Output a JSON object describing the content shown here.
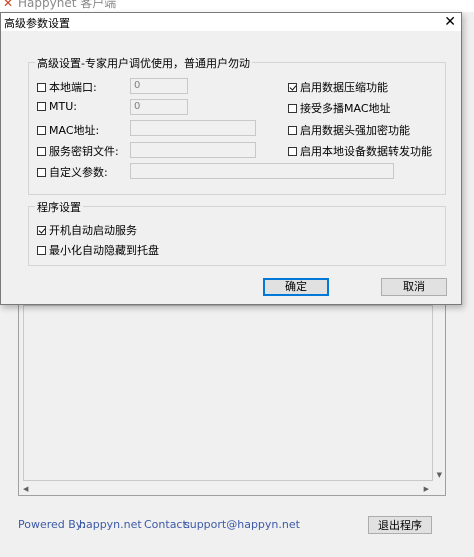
{
  "main_window": {
    "title": "Happynet 客户端",
    "footer_powered_label": "Powered By:",
    "footer_powered_link": "happyn.net",
    "footer_contact_label": "Contact:",
    "footer_contact_email": "support@happyn.net",
    "exit_button": "退出程序"
  },
  "dialog": {
    "title": "高级参数设置",
    "close_glyph": "✕",
    "advanced_group": {
      "label": "高级设置-专家用户调优使用，普通用户勿动",
      "local_port": {
        "label": "本地端口:",
        "checked": false,
        "value": "0"
      },
      "mtu": {
        "label": "MTU:",
        "checked": false,
        "value": "0"
      },
      "mac": {
        "label": "MAC地址:",
        "checked": false,
        "value": ""
      },
      "service_key": {
        "label": "服务密钥文件:",
        "checked": false,
        "value": ""
      },
      "custom_params": {
        "label": "自定义参数:",
        "checked": false,
        "value": ""
      },
      "compression": {
        "label": "启用数据压缩功能",
        "checked": true
      },
      "multicast": {
        "label": "接受多播MAC地址",
        "checked": false
      },
      "header_encrypt": {
        "label": "启用数据头强加密功能",
        "checked": false
      },
      "local_forward": {
        "label": "启用本地设备数据转发功能",
        "checked": false
      }
    },
    "program_group": {
      "label": "程序设置",
      "autostart": {
        "label": "开机自动启动服务",
        "checked": true
      },
      "minimize_tray": {
        "label": "最小化自动隐藏到托盘",
        "checked": false
      }
    },
    "ok_button": "确定",
    "cancel_button": "取消"
  }
}
